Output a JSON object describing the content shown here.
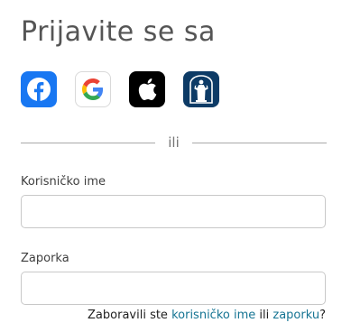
{
  "login": {
    "title": "Prijavite se sa",
    "providers": [
      {
        "name": "Facebook",
        "icon": "facebook-icon",
        "color": "#1877f2"
      },
      {
        "name": "Google",
        "icon": "google-icon",
        "color": "#ffffff"
      },
      {
        "name": "Apple",
        "icon": "apple-icon",
        "color": "#000000"
      },
      {
        "name": "Church Account",
        "icon": "church-statue-icon",
        "color": "#0d3b66"
      }
    ],
    "divider_text": "ili",
    "username_label": "Korisničko ime",
    "username_value": "",
    "password_label": "Zaporka",
    "password_value": "",
    "forgot_prefix": "Zaboravili ste",
    "forgot_username_link": "korisničko ime",
    "forgot_middle": "ili",
    "forgot_password_link": "zaporku",
    "forgot_suffix": "?"
  },
  "colors": {
    "link": "#157493",
    "title_text": "#555555",
    "divider": "#a9a9a9"
  }
}
